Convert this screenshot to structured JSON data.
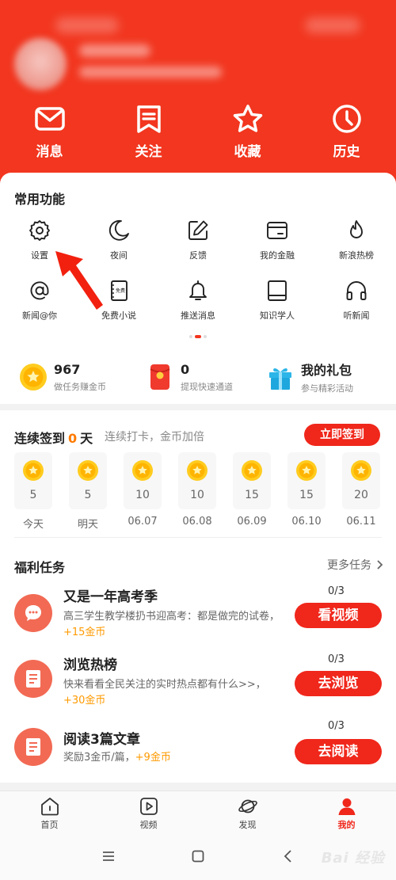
{
  "header": {
    "quick_actions": [
      {
        "label": "消息",
        "icon": "mail-icon"
      },
      {
        "label": "关注",
        "icon": "bookmark-icon"
      },
      {
        "label": "收藏",
        "icon": "star-icon"
      },
      {
        "label": "历史",
        "icon": "clock-icon"
      }
    ]
  },
  "common": {
    "title": "常用功能",
    "row1": [
      {
        "label": "设置",
        "icon": "gear-icon"
      },
      {
        "label": "夜间",
        "icon": "moon-icon"
      },
      {
        "label": "反馈",
        "icon": "edit-icon"
      },
      {
        "label": "我的金融",
        "icon": "wallet-icon"
      },
      {
        "label": "新浪热榜",
        "icon": "flame-icon"
      }
    ],
    "row2": [
      {
        "label": "新闻@你",
        "icon": "at-icon"
      },
      {
        "label": "免费小说",
        "icon": "book-icon"
      },
      {
        "label": "推送消息",
        "icon": "bell-icon"
      },
      {
        "label": "知识学人",
        "icon": "notebook-icon"
      },
      {
        "label": "听新闻",
        "icon": "headphones-icon"
      }
    ],
    "book_icon_text": "免费"
  },
  "stats": [
    {
      "value": "967",
      "sub": "做任务赚金币",
      "icon": "coin-icon"
    },
    {
      "value": "0",
      "sub": "提现快速通道",
      "icon": "red-packet-icon"
    },
    {
      "value": "我的礼包",
      "sub": "参与精彩活动",
      "icon": "gift-icon"
    }
  ],
  "sign": {
    "prefix": "连续签到",
    "days": "0",
    "suffix": "天",
    "subtitle": "连续打卡，金币加倍",
    "button": "立即签到",
    "items": [
      {
        "value": "5",
        "label": "今天"
      },
      {
        "value": "5",
        "label": "明天"
      },
      {
        "value": "10",
        "label": "06.07"
      },
      {
        "value": "10",
        "label": "06.08"
      },
      {
        "value": "15",
        "label": "06.09"
      },
      {
        "value": "15",
        "label": "06.10"
      },
      {
        "value": "20",
        "label": "06.11"
      }
    ]
  },
  "tasks": {
    "title": "福利任务",
    "more": "更多任务",
    "items": [
      {
        "title": "又是一年高考季",
        "desc": "高三学生教学楼扔书迎高考：都是做完的试卷，",
        "reward": "+15金币",
        "count": "0/3",
        "button": "看视频",
        "icon": "chat-icon"
      },
      {
        "title": "浏览热榜",
        "desc": "快来看看全民关注的实时热点都有什么>>，",
        "reward": "+30金币",
        "count": "0/3",
        "button": "去浏览",
        "icon": "document-icon"
      },
      {
        "title": "阅读3篇文章",
        "desc": "奖励3金币/篇，",
        "reward": "+9金币",
        "count": "0/3",
        "button": "去阅读",
        "icon": "document-icon"
      }
    ]
  },
  "bottom_nav": [
    {
      "label": "首页",
      "icon": "home-icon"
    },
    {
      "label": "视频",
      "icon": "video-icon"
    },
    {
      "label": "发现",
      "icon": "planet-icon"
    },
    {
      "label": "我的",
      "icon": "user-icon",
      "active": true
    }
  ],
  "watermark": "Bai 经验",
  "colors": {
    "brand": "#f2361f",
    "button": "#f0271b",
    "gold": "#ff9a00",
    "days": "#ff7a00"
  }
}
